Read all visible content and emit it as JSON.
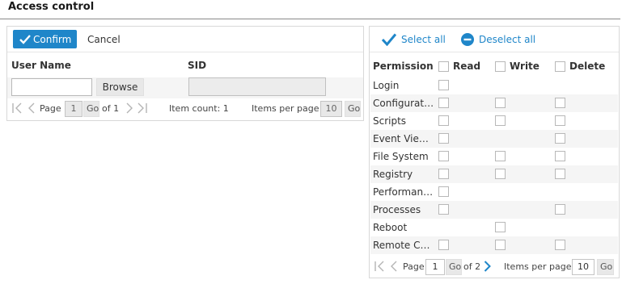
{
  "page": {
    "title": "Access control"
  },
  "left": {
    "confirm_label": "Confirm",
    "cancel_label": "Cancel",
    "columns": {
      "user_name": "User Name",
      "sid": "SID"
    },
    "browse_label": "Browse",
    "user_name_value": "",
    "sid_value": "",
    "pager": {
      "page_label": "Page",
      "page_value": "1",
      "go_label": "Go",
      "of_label": "of 1",
      "item_count": "Item count: 1",
      "per_page_label": "Items per page",
      "per_page_value": "10",
      "go2_label": "Go"
    }
  },
  "right": {
    "select_all_label": "Select all",
    "deselect_all_label": "Deselect all",
    "columns": {
      "permission": "Permission",
      "read": "Read",
      "write": "Write",
      "delete": "Delete"
    },
    "rows": [
      {
        "name": "Login",
        "read": true,
        "write": false,
        "delete": false
      },
      {
        "name": "Configuration",
        "read": true,
        "write": true,
        "delete": true
      },
      {
        "name": "Scripts",
        "read": true,
        "write": true,
        "delete": true
      },
      {
        "name": "Event Viewer",
        "read": true,
        "write": false,
        "delete": true
      },
      {
        "name": "File System",
        "read": true,
        "write": true,
        "delete": true
      },
      {
        "name": "Registry",
        "read": true,
        "write": true,
        "delete": true
      },
      {
        "name": "Performanc...",
        "read": true,
        "write": false,
        "delete": false
      },
      {
        "name": "Processes",
        "read": true,
        "write": false,
        "delete": true
      },
      {
        "name": "Reboot",
        "read": false,
        "write": true,
        "delete": false
      },
      {
        "name": "Remote Co...",
        "read": true,
        "write": true,
        "delete": true
      }
    ],
    "pager": {
      "page_label": "Page",
      "page_value": "1",
      "go_label": "Go",
      "of_label": "of 2",
      "per_page_label": "Items per page",
      "per_page_value": "10",
      "go2_label": "Go"
    }
  },
  "colors": {
    "accent": "#1f86c9",
    "row_alt": "#f5f5f5",
    "border": "#d8d8d8"
  },
  "icons": [
    "checkmark-icon",
    "minus-circle-icon",
    "first-page-icon",
    "prev-page-icon",
    "next-page-icon",
    "last-page-icon"
  ]
}
